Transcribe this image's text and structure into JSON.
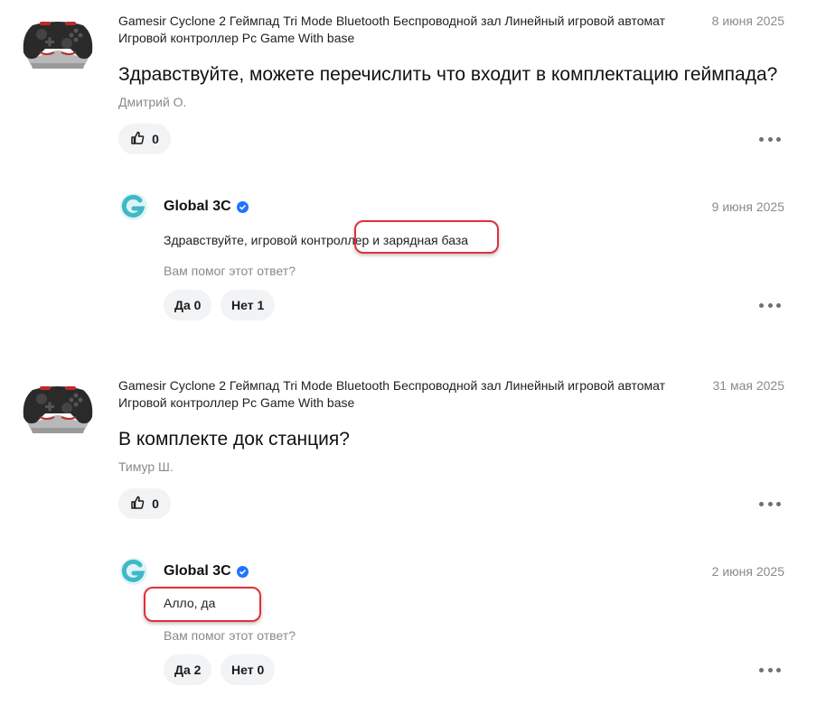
{
  "questions": [
    {
      "product": "Gamesir Cyclone 2 Геймпад Tri Mode Bluetooth Беспроводной зал Линейный игровой автомат Игровой контроллер Pc Game With base",
      "date": "8 июня 2025",
      "question": "Здравствуйте, можете перечислить что входит в комплектацию геймпада?",
      "author": "Дмитрий О.",
      "likes": "0",
      "answer": {
        "seller": "Global 3C",
        "date": "9 июня 2025",
        "text": "Здравствуйте, игровой контроллер и зарядная база",
        "helpful_prompt": "Вам помог этот ответ?",
        "yes": "Да 0",
        "no": "Нет 1"
      }
    },
    {
      "product": "Gamesir Cyclone 2 Геймпад Tri Mode Bluetooth Беспроводной зал Линейный игровой автомат Игровой контроллер Pc Game With base",
      "date": "31 мая 2025",
      "question": "В комплекте док станция?",
      "author": "Тимур Ш.",
      "likes": "0",
      "answer": {
        "seller": "Global 3C",
        "date": "2 июня 2025",
        "text": "Алло, да",
        "helpful_prompt": "Вам помог этот ответ?",
        "yes": "Да 2",
        "no": "Нет 0"
      }
    }
  ],
  "colors": {
    "highlight": "#e0303a",
    "verified": "#1f73ff",
    "logo": "#3fb8c8",
    "pill": "#f2f3f5"
  },
  "icons": [
    "thumbs-up-icon",
    "verified-badge-icon",
    "more-dots-icon",
    "seller-logo-icon",
    "gamepad-thumbnail"
  ]
}
